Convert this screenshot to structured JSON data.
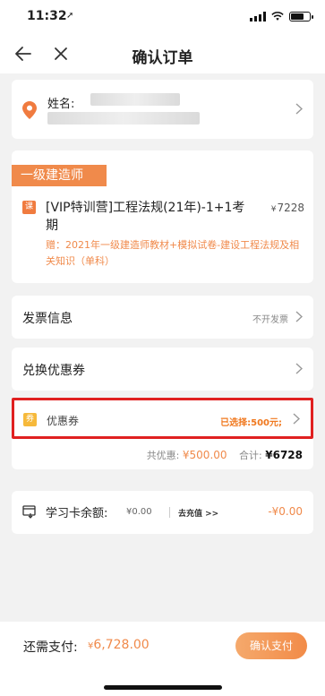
{
  "status": {
    "time": "11:32"
  },
  "nav": {
    "title": "确认订单"
  },
  "address": {
    "name_label": "姓名:"
  },
  "course": {
    "category": "一级建造师",
    "badge": "课",
    "name": "[VIP特训营]工程法规(21年)-1+1考期",
    "currency": "¥",
    "price": "7228",
    "gift": "赠：2021年一级建造师教材+模拟试卷-建设工程法规及相关知识（单科）"
  },
  "invoice": {
    "label": "发票信息",
    "value": "不开发票"
  },
  "exchange": {
    "label": "兑换优惠券"
  },
  "coupon": {
    "badge": "券",
    "label": "优惠券",
    "selected": "已选择:500元;",
    "discount_label": "共优惠:",
    "discount_value": "¥500.00",
    "total_label": "合计:",
    "total_value": "¥6728"
  },
  "study_card": {
    "label": "学习卡余额:",
    "balance": "¥0.00",
    "recharge": "去充值 >>",
    "deduction": "-¥0.00"
  },
  "bottom": {
    "need_label": "还需支付:",
    "currency": "¥",
    "amount": "6,728.00",
    "pay_button": "确认支付"
  },
  "colors": {
    "accent": "#f08a4b",
    "highlight_border": "#e02020",
    "coupon_badge": "#f6b93b"
  }
}
